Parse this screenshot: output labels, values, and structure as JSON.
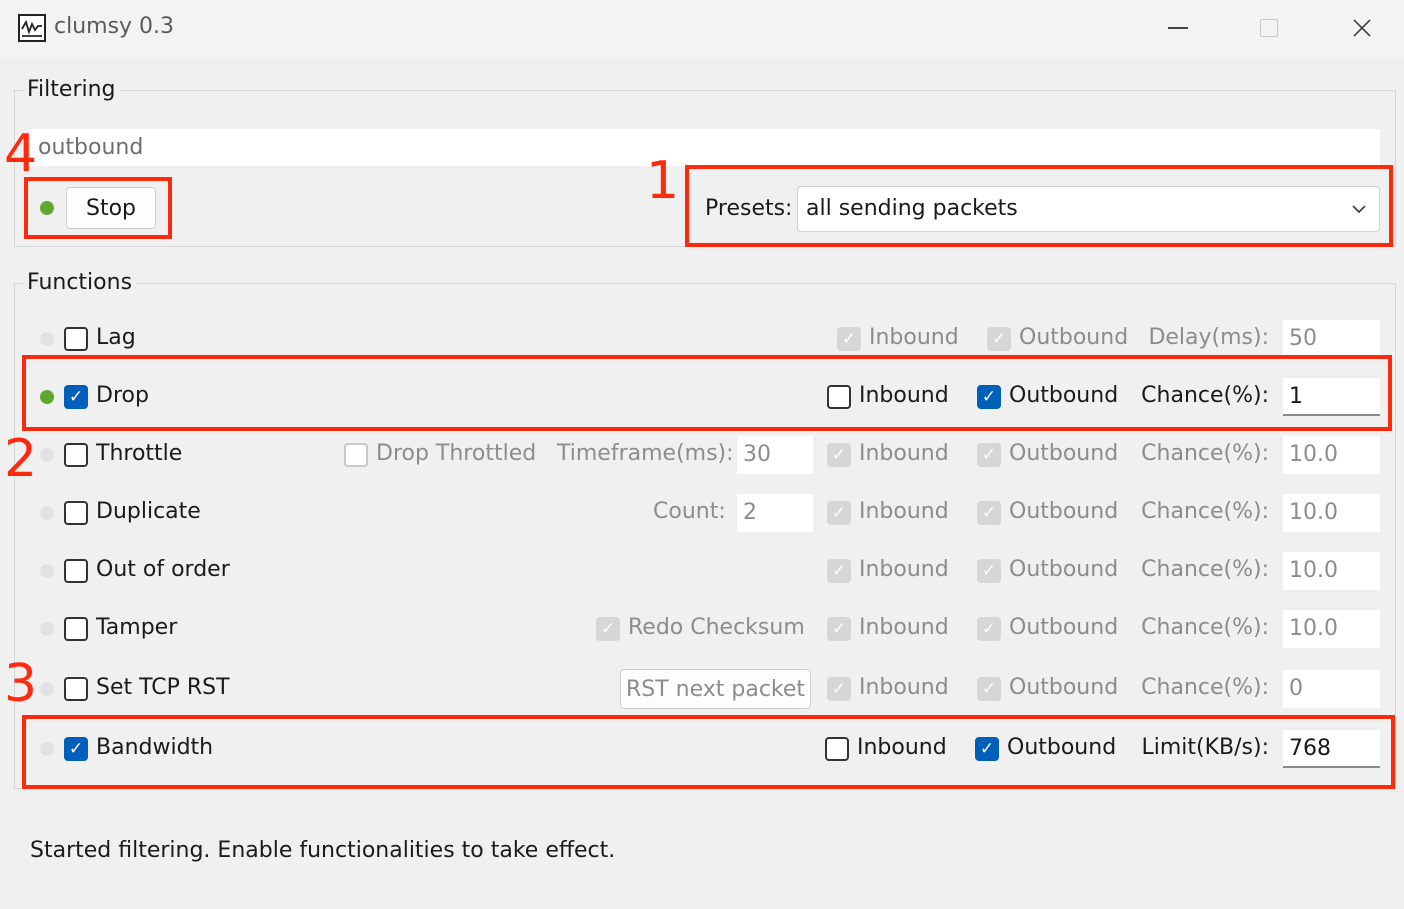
{
  "window": {
    "title": "clumsy 0.3",
    "icon": "waveform-icon"
  },
  "filtering": {
    "group_title": "Filtering",
    "filter_value": "outbound",
    "status": "on",
    "stop_label": "Stop",
    "presets_label": "Presets:",
    "preset_selected": "all sending packets"
  },
  "functions": {
    "group_title": "Functions",
    "rows": [
      {
        "name": "Lag",
        "enabled": false,
        "active": false,
        "inbound": true,
        "outbound": true,
        "inbound_label": "Inbound",
        "outbound_label": "Outbound",
        "param_label": "Delay(ms):",
        "param_value": "50"
      },
      {
        "name": "Drop",
        "enabled": true,
        "active": true,
        "inbound": false,
        "outbound": true,
        "inbound_label": "Inbound",
        "outbound_label": "Outbound",
        "param_label": "Chance(%):",
        "param_value": "1"
      },
      {
        "name": "Throttle",
        "enabled": false,
        "active": false,
        "inbound": true,
        "outbound": true,
        "inbound_label": "Inbound",
        "outbound_label": "Outbound",
        "param_label": "Chance(%):",
        "param_value": "10.0",
        "extra_check_label": "Drop Throttled",
        "extra_check": false,
        "extra_param_label": "Timeframe(ms):",
        "extra_param_value": "30"
      },
      {
        "name": "Duplicate",
        "enabled": false,
        "active": false,
        "inbound": true,
        "outbound": true,
        "inbound_label": "Inbound",
        "outbound_label": "Outbound",
        "param_label": "Chance(%):",
        "param_value": "10.0",
        "extra_param_label": "Count:",
        "extra_param_value": "2"
      },
      {
        "name": "Out of order",
        "enabled": false,
        "active": false,
        "inbound": true,
        "outbound": true,
        "inbound_label": "Inbound",
        "outbound_label": "Outbound",
        "param_label": "Chance(%):",
        "param_value": "10.0"
      },
      {
        "name": "Tamper",
        "enabled": false,
        "active": false,
        "inbound": true,
        "outbound": true,
        "inbound_label": "Inbound",
        "outbound_label": "Outbound",
        "param_label": "Chance(%):",
        "param_value": "10.0",
        "extra_check_label": "Redo Checksum",
        "extra_check": true
      },
      {
        "name": "Set TCP RST",
        "enabled": false,
        "active": false,
        "inbound": true,
        "outbound": true,
        "inbound_label": "Inbound",
        "outbound_label": "Outbound",
        "param_label": "Chance(%):",
        "param_value": "0",
        "extra_button_label": "RST next packet"
      },
      {
        "name": "Bandwidth",
        "enabled": true,
        "active": false,
        "inbound": false,
        "outbound": true,
        "inbound_label": "Inbound",
        "outbound_label": "Outbound",
        "param_label": "Limit(KB/s):",
        "param_value": "768"
      }
    ]
  },
  "status_bar": {
    "message": "Started filtering. Enable functionalities to take effect."
  },
  "annotations": {
    "callout_1": "1",
    "callout_2": "2",
    "callout_3": "3",
    "callout_4": "4",
    "color": "#ff2a0d"
  },
  "colors": {
    "accent": "#005fb8",
    "status_on": "#5fa830",
    "background": "#f0f0f0"
  }
}
